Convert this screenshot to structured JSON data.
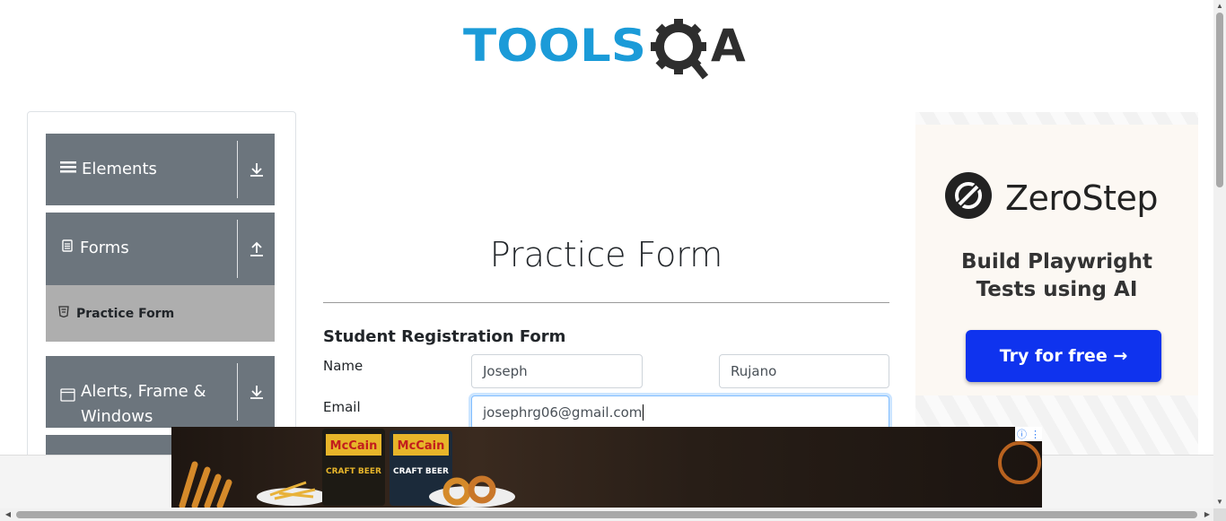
{
  "header": {
    "logo_text_left": "TOOLS",
    "logo_text_right": "A"
  },
  "sidebar": {
    "groups": [
      {
        "label": "Elements",
        "icon": "menu-icon",
        "arrow": "download-arrow-icon"
      },
      {
        "label": "Forms",
        "icon": "document-icon",
        "arrow": "upload-arrow-icon"
      },
      {
        "label": "Alerts, Frame &",
        "label_line2": "Windows",
        "icon": "window-icon",
        "arrow": "download-arrow-icon"
      }
    ],
    "active_item": {
      "label": "Practice Form",
      "icon": "html5-icon"
    }
  },
  "form": {
    "title": "Practice Form",
    "subtitle": "Student Registration Form",
    "name_label": "Name",
    "first_name_value": "Joseph",
    "last_name_value": "Rujano",
    "email_label": "Email",
    "email_value": "josephrg06@gmail.com"
  },
  "ad_right": {
    "brand": "ZeroStep",
    "headline_line1": "Build Playwright",
    "headline_line2": "Tests using AI",
    "cta": "Try for free →",
    "accent": "#0f33ee"
  },
  "ad_bottom": {
    "brand_1": "McCain",
    "product_1": "CRAFT BEER",
    "brand_2": "McCain",
    "product_2": "CRAFT BEER"
  },
  "colors": {
    "logo_blue": "#1b9bd8",
    "logo_dark": "#2e2e2e",
    "sidebar_group": "#6c757d",
    "sidebar_active": "#aeaeae"
  }
}
